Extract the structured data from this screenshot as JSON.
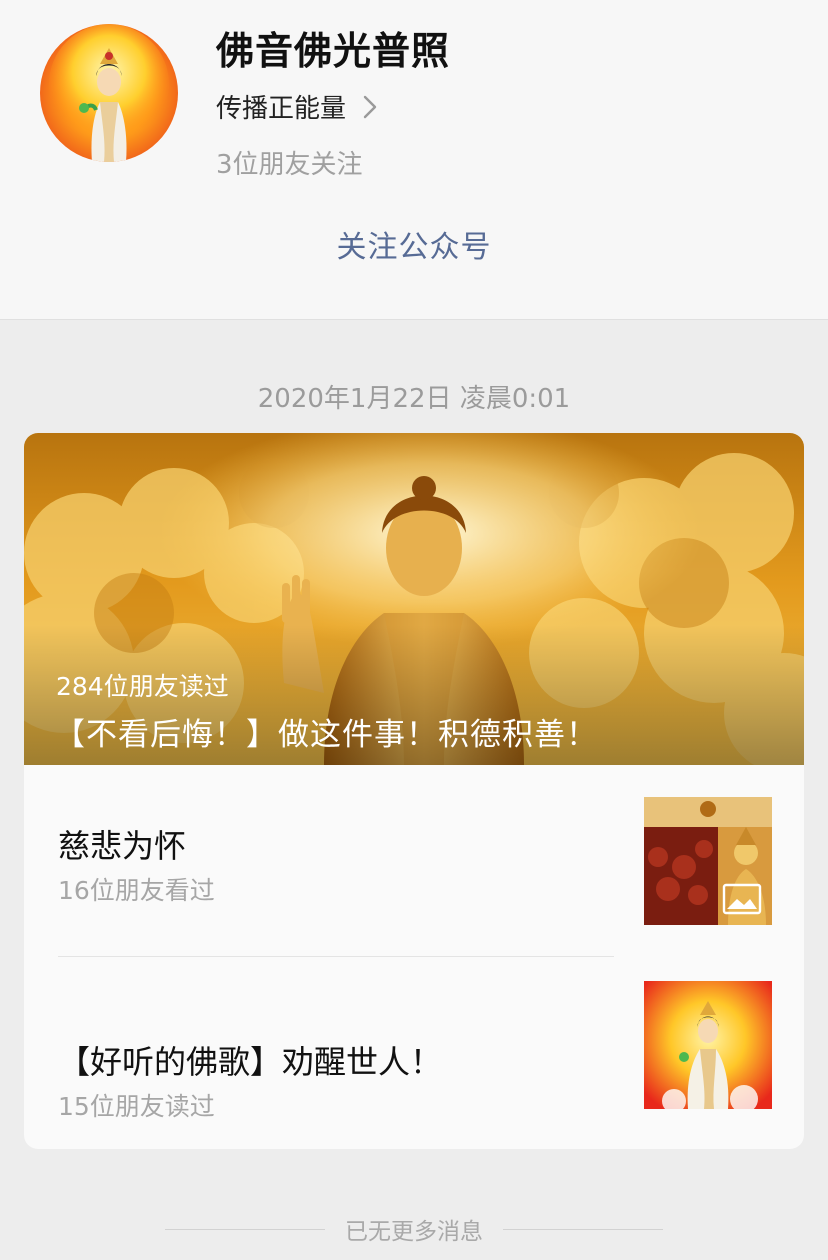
{
  "account": {
    "name": "佛音佛光普照",
    "description": "传播正能量",
    "friends_following": "3位朋友关注",
    "follow_label": "关注公众号"
  },
  "message": {
    "date": "2020年1月22日 凌晨0:01",
    "cover": {
      "reads": "284位朋友读过",
      "title": "【不看后悔！】做这件事！积德积善！"
    },
    "items": [
      {
        "title": "慈悲为怀",
        "reads": "16位朋友看过",
        "thumb_icon": "image-icon"
      },
      {
        "title": "【好听的佛歌】劝醒世人！",
        "reads": "15位朋友读过"
      }
    ]
  },
  "footer": {
    "no_more": "已无更多消息"
  },
  "colors": {
    "link": "#576b95",
    "page_bg": "#ededed",
    "header_bg": "#f7f7f7"
  }
}
